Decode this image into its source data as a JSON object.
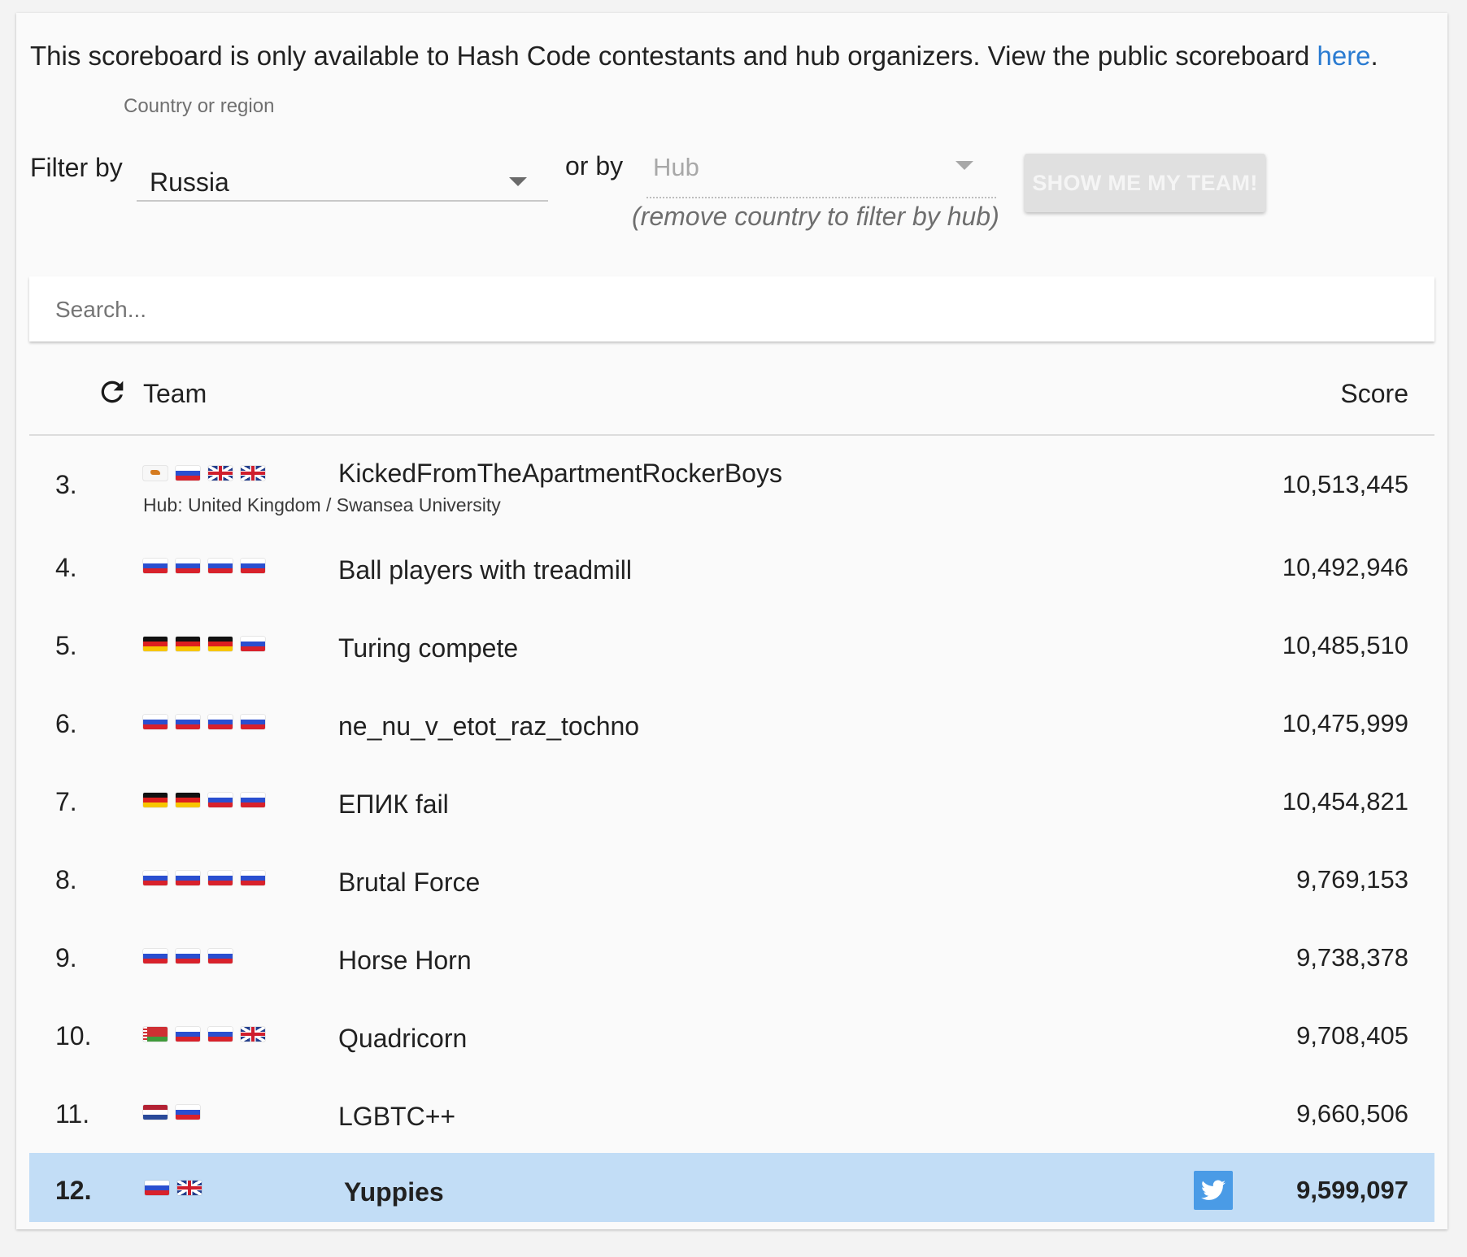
{
  "notice": {
    "text": "This scoreboard is only available to Hash Code contestants and hub organizers. View the public scoreboard ",
    "link_text": "here",
    "suffix": "."
  },
  "filters": {
    "filter_by_label": "Filter by",
    "country_caption": "Country or region",
    "country_value": "Russia",
    "or_by_label": "or by",
    "hub_placeholder": "Hub",
    "hub_hint": "(remove country to filter by hub)",
    "show_team_button": "SHOW ME MY TEAM!"
  },
  "search": {
    "placeholder": "Search..."
  },
  "table": {
    "header": {
      "team": "Team",
      "score": "Score",
      "refresh_icon": "refresh-icon"
    },
    "rows": [
      {
        "rank": "3.",
        "flags": [
          "cy",
          "ru",
          "gb",
          "gb"
        ],
        "team": "KickedFromTheApartmentRockerBoys",
        "hub": "Hub: United Kingdom / Swansea University",
        "score": "10,513,445"
      },
      {
        "rank": "4.",
        "flags": [
          "ru",
          "ru",
          "ru",
          "ru"
        ],
        "team": "Ball players with treadmill",
        "score": "10,492,946"
      },
      {
        "rank": "5.",
        "flags": [
          "de",
          "de",
          "de",
          "ru"
        ],
        "team": "Turing compete",
        "score": "10,485,510"
      },
      {
        "rank": "6.",
        "flags": [
          "ru",
          "ru",
          "ru",
          "ru"
        ],
        "team": "ne_nu_v_etot_raz_tochno",
        "score": "10,475,999"
      },
      {
        "rank": "7.",
        "flags": [
          "de",
          "de",
          "ru",
          "ru"
        ],
        "team": "ЕПИК fail",
        "score": "10,454,821"
      },
      {
        "rank": "8.",
        "flags": [
          "ru",
          "ru",
          "ru",
          "ru"
        ],
        "team": "Brutal Force",
        "score": "9,769,153"
      },
      {
        "rank": "9.",
        "flags": [
          "ru",
          "ru",
          "ru"
        ],
        "team": "Horse Horn",
        "score": "9,738,378"
      },
      {
        "rank": "10.",
        "flags": [
          "by",
          "ru",
          "ru",
          "gb"
        ],
        "team": "Quadricorn",
        "score": "9,708,405"
      },
      {
        "rank": "11.",
        "flags": [
          "nl",
          "ru"
        ],
        "team": "LGBTC++",
        "score": "9,660,506"
      },
      {
        "rank": "12.",
        "flags": [
          "ru",
          "gb"
        ],
        "team": "Yuppies",
        "score": "9,599,097",
        "highlighted": true,
        "share_icon": "twitter-icon"
      }
    ]
  },
  "colors": {
    "link": "#2a7bd1",
    "highlight_row": "#c2ddf6",
    "twitter": "#4a9be6"
  }
}
